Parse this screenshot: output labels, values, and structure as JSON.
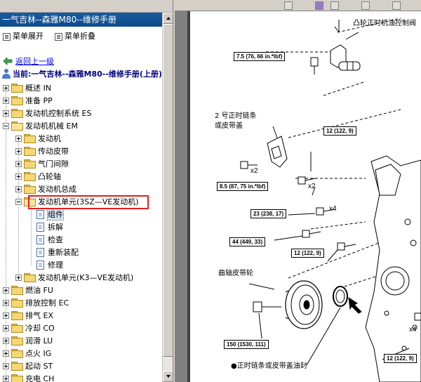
{
  "window": {
    "title": "一气吉林--森雅M80--维修手册"
  },
  "toolbar": {
    "expand_label": "菜单展开",
    "collapse_label": "菜单折叠"
  },
  "nav": {
    "back_label": "返回上一级",
    "current_label": "当前:一气吉林--森雅M80--维修手册(上册)"
  },
  "tree": [
    {
      "label": "概述 IN",
      "level": 0,
      "expander": "plus",
      "icon": "folder"
    },
    {
      "label": "准备 PP",
      "level": 0,
      "expander": "plus",
      "icon": "folder"
    },
    {
      "label": "发动机控制系统 ES",
      "level": 0,
      "expander": "plus",
      "icon": "folder"
    },
    {
      "label": "发动机机械 EM",
      "level": 0,
      "expander": "minus",
      "icon": "folder-open"
    },
    {
      "label": "发动机",
      "level": 1,
      "expander": "plus",
      "icon": "folder"
    },
    {
      "label": "传动皮带",
      "level": 1,
      "expander": "plus",
      "icon": "folder"
    },
    {
      "label": "气门间隙",
      "level": 1,
      "expander": "plus",
      "icon": "folder"
    },
    {
      "label": "凸轮轴",
      "level": 1,
      "expander": "plus",
      "icon": "folder"
    },
    {
      "label": "发动机总成",
      "level": 1,
      "expander": "plus",
      "icon": "folder"
    },
    {
      "label": "发动机单元(3SZ—VE发动机)",
      "level": 1,
      "expander": "minus",
      "icon": "folder-open"
    },
    {
      "label": "组件",
      "level": 2,
      "expander": "none",
      "icon": "doc",
      "selected": true
    },
    {
      "label": "拆解",
      "level": 2,
      "expander": "none",
      "icon": "doc"
    },
    {
      "label": "检查",
      "level": 2,
      "expander": "none",
      "icon": "doc"
    },
    {
      "label": "重新装配",
      "level": 2,
      "expander": "none",
      "icon": "doc"
    },
    {
      "label": "修理",
      "level": 2,
      "expander": "none",
      "icon": "doc"
    },
    {
      "label": "发动机单元(K3—VE发动机)",
      "level": 1,
      "expander": "plus",
      "icon": "folder"
    },
    {
      "label": "燃油 FU",
      "level": 0,
      "expander": "plus",
      "icon": "folder"
    },
    {
      "label": "排放控制 EC",
      "level": 0,
      "expander": "plus",
      "icon": "folder"
    },
    {
      "label": "排气 EX",
      "level": 0,
      "expander": "plus",
      "icon": "folder"
    },
    {
      "label": "冷却 CO",
      "level": 0,
      "expander": "plus",
      "icon": "folder"
    },
    {
      "label": "润滑 LU",
      "level": 0,
      "expander": "plus",
      "icon": "folder"
    },
    {
      "label": "点火 IG",
      "level": 0,
      "expander": "plus",
      "icon": "folder"
    },
    {
      "label": "起动 ST",
      "level": 0,
      "expander": "plus",
      "icon": "folder"
    },
    {
      "label": "充电 CH",
      "level": 0,
      "expander": "plus",
      "icon": "folder"
    }
  ],
  "diagram": {
    "labels": {
      "cam_valve": "凸轮正时机油控制阀",
      "chain_cover_l1": "2 号正时链条",
      "chain_cover_l2": "或皮带盖",
      "pulley": "曲轴皮带轮",
      "oil_seal": "●正时链条或皮带盖油封"
    },
    "torques": {
      "t1": "7.5 (76, 66 in.*lbf)",
      "t2": "12 (122, 9)",
      "t3": "8.5 (87, 75 in.*lbf)",
      "t4": "23 (238, 17)",
      "t5": "44 (449, 33)",
      "t6": "12 (122, 9)",
      "t7": "150 (1530, 111)",
      "t8": "12 (122, 9)"
    },
    "multipliers": {
      "m1": "x2",
      "m2": "x2",
      "m3": "x4",
      "m4": "x4"
    }
  }
}
